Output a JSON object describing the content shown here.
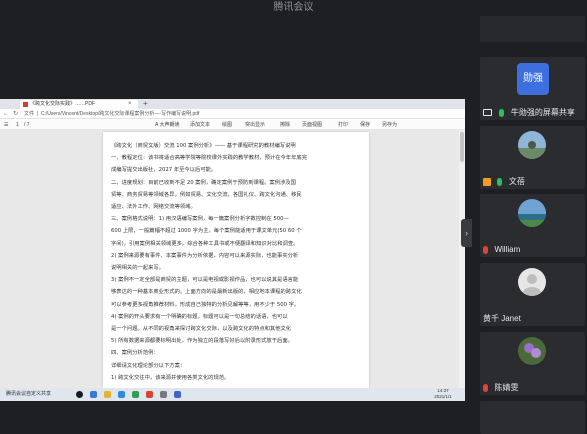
{
  "window": {
    "title": "腾讯会议"
  },
  "browser": {
    "tab_label": "《跨文化交际实践》……PDF",
    "tab_close": "×",
    "tab_new": "+",
    "back": "←",
    "forward": "→",
    "reload": "↻",
    "address_prefix": "文件",
    "address": "C:/Users/Vincent/Desktop/跨文化交际课程案例分析----写作编写说明.pdf"
  },
  "pdf_toolbar": {
    "zoom": "1",
    "page_of": "/ 7",
    "items": [
      "A 大声朗读",
      "添加文本",
      "绘图",
      "突出显示",
      "擦除",
      "页面视图",
      "打印",
      "保存",
      "另存为"
    ]
  },
  "pdf_lines": [
    "《跨文化（商贸文版）交流 100 案例分析》—— 基于课程研究的教材编写说明",
    "一、教程定位：该书将适合高等学院等院校课外实践的教学教材，预计在今年年底完",
    "成编写提交出版社，2027 年至今以后可能。",
    "二、进度规划：目前已收到不足 20 案例，确定案例于预防到课程。案例涉及国",
    "贸等、商务贸易等领域各异，例如贸易、文化交流、各国礼仪、跨文化沟通、移民",
    "适应、法外工作、网络交流等领域。",
    "三、案例格式说明：1) 用汉语编写案例，每一篇案例分析字数控制在 500—",
    "600 上限，一般篇幅不超过 1000 字为主，每个案例能适用于课文单元(50 60 个",
    "字间)，引用案例相关领域更多。综合各种工具书或不便翻译和知识对比和调查。",
    "2) 案例来源要有事件、本案事件为分析依据，内容可以来源实际，也能事实分析",
    "说明相关的一起来写。",
    "3) 案例不一定全部是商贸的主题，可以是电视或影视作品，也可以说其是语言能",
    "够表达的一种基本商业形式的。上面方向的是最新出版的，相应地本课程的跨文化",
    "可以参考更多视角推荐材料，形成自己独特的分析见解等等，用不少于 500 字。",
    "4) 案例的开头要求有一个明确的标题，标题可以是一句总结的话语，也可以",
    "是一个问题。从不同的视角来探讨跨文化交际，以及跨文化的特点和其他文化",
    "5) 所有数据来源都要标明出处，作为独立的段落写好后以附录形式放于后面。",
    "四、案例分析范例：",
    "详细请文化理论部分以下方案：",
    "1) 跨文化交往中，该来源并使用各类文化的规范。"
  ],
  "taskbar": {
    "label": "腾讯会议自定义共享",
    "time": "14:37",
    "date": "2021/1/1"
  },
  "sidebar": {
    "participants": [
      {
        "avatar_text": "勋强",
        "name": "牛勋强的屏幕共享",
        "mic": "active",
        "sharing": true
      },
      {
        "name": "文蓓",
        "mic": "active",
        "photo": "landscape"
      },
      {
        "name": "William",
        "mic": "muted",
        "photo": "sea"
      },
      {
        "name": "黄千 Janet",
        "mic": "none",
        "photo": "default"
      },
      {
        "name": "陈婧雯",
        "mic": "muted",
        "photo": "flower"
      }
    ]
  },
  "colors": {
    "app_bg": "#1e1f22",
    "tile_bg": "#2b2c30",
    "accent_blue": "#3e6fe0",
    "mic_green": "#2fbe5d",
    "mic_red": "#e1423c"
  }
}
